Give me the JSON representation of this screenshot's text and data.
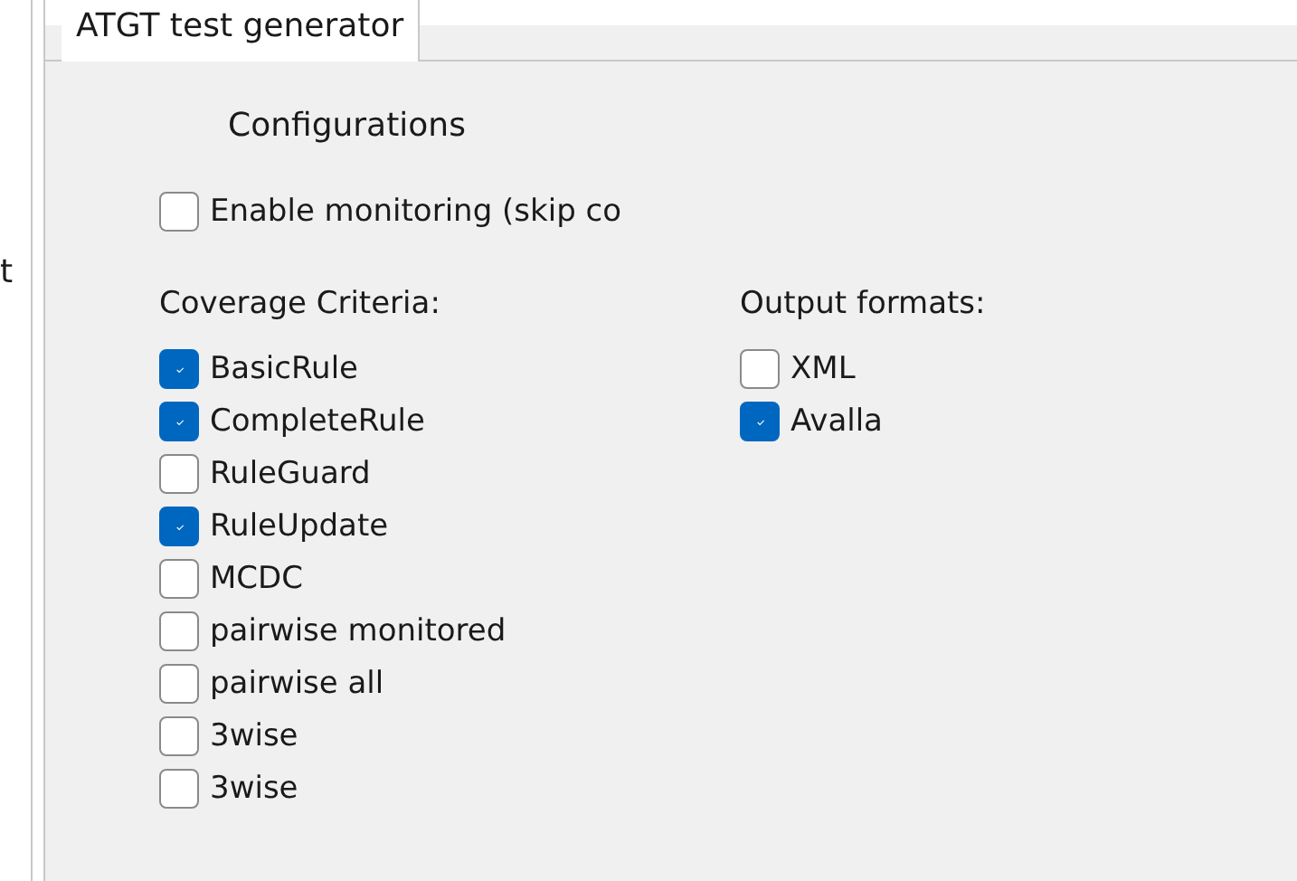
{
  "left_pane": {
    "text": "t"
  },
  "tab": {
    "label": "ATGT test generator",
    "selected": true
  },
  "section_title": "Configurations",
  "monitoring": {
    "label": "Enable monitoring (skip co",
    "checked": false
  },
  "coverage_criteria": {
    "title": "Coverage Criteria:",
    "items": [
      {
        "label": "BasicRule",
        "checked": true
      },
      {
        "label": "CompleteRule",
        "checked": true
      },
      {
        "label": "RuleGuard",
        "checked": false
      },
      {
        "label": "RuleUpdate",
        "checked": true
      },
      {
        "label": "MCDC",
        "checked": false
      },
      {
        "label": "pairwise monitored",
        "checked": false
      },
      {
        "label": "pairwise all",
        "checked": false
      },
      {
        "label": "3wise",
        "checked": false
      },
      {
        "label": "3wise",
        "checked": false
      }
    ]
  },
  "output_formats": {
    "title": "Output formats:",
    "items": [
      {
        "label": "XML",
        "checked": false
      },
      {
        "label": "Avalla",
        "checked": true
      }
    ]
  }
}
